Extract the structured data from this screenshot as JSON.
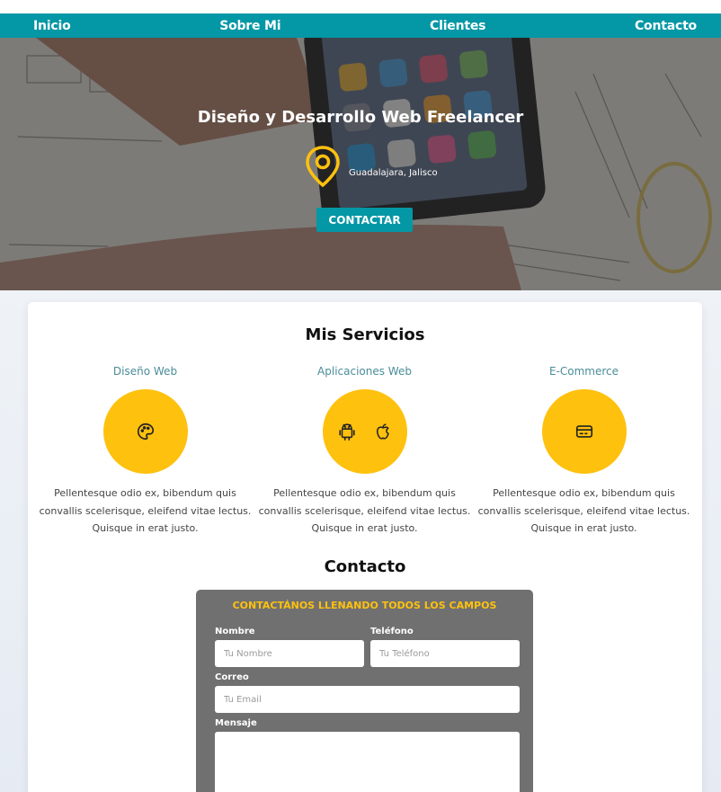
{
  "nav": {
    "items": [
      "Inicio",
      "Sobre Mi",
      "Clientes",
      "Contacto"
    ]
  },
  "hero": {
    "title": "Diseño y Desarrollo Web Freelancer",
    "location": "Guadalajara, Jalisco",
    "location_icon": "map-pin-icon",
    "button_label": "CONTACTAR"
  },
  "services": {
    "title": "Mis Servicios",
    "items": [
      {
        "title": "Diseño Web",
        "icons": [
          "palette-icon"
        ],
        "description": "Pellentesque odio ex, bibendum quis convallis scelerisque, eleifend vitae lectus. Quisque in erat justo."
      },
      {
        "title": "Aplicaciones Web",
        "icons": [
          "android-icon",
          "apple-icon"
        ],
        "description": "Pellentesque odio ex, bibendum quis convallis scelerisque, eleifend vitae lectus. Quisque in erat justo."
      },
      {
        "title": "E-Commerce",
        "icons": [
          "credit-card-icon"
        ],
        "description": "Pellentesque odio ex, bibendum quis convallis scelerisque, eleifend vitae lectus. Quisque in erat justo."
      }
    ]
  },
  "contact": {
    "title": "Contacto",
    "form_heading": "CONTACTÁNOS LLENANDO TODOS LOS CAMPOS",
    "name_label": "Nombre",
    "name_placeholder": "Tu Nombre",
    "phone_label": "Teléfono",
    "phone_placeholder": "Tu Teléfono",
    "email_label": "Correo",
    "email_placeholder": "Tu Email",
    "message_label": "Mensaje"
  },
  "colors": {
    "primary": "#0497a6",
    "accent": "#fec10e",
    "form_bg": "#707070",
    "service_title": "#4a8d99"
  }
}
